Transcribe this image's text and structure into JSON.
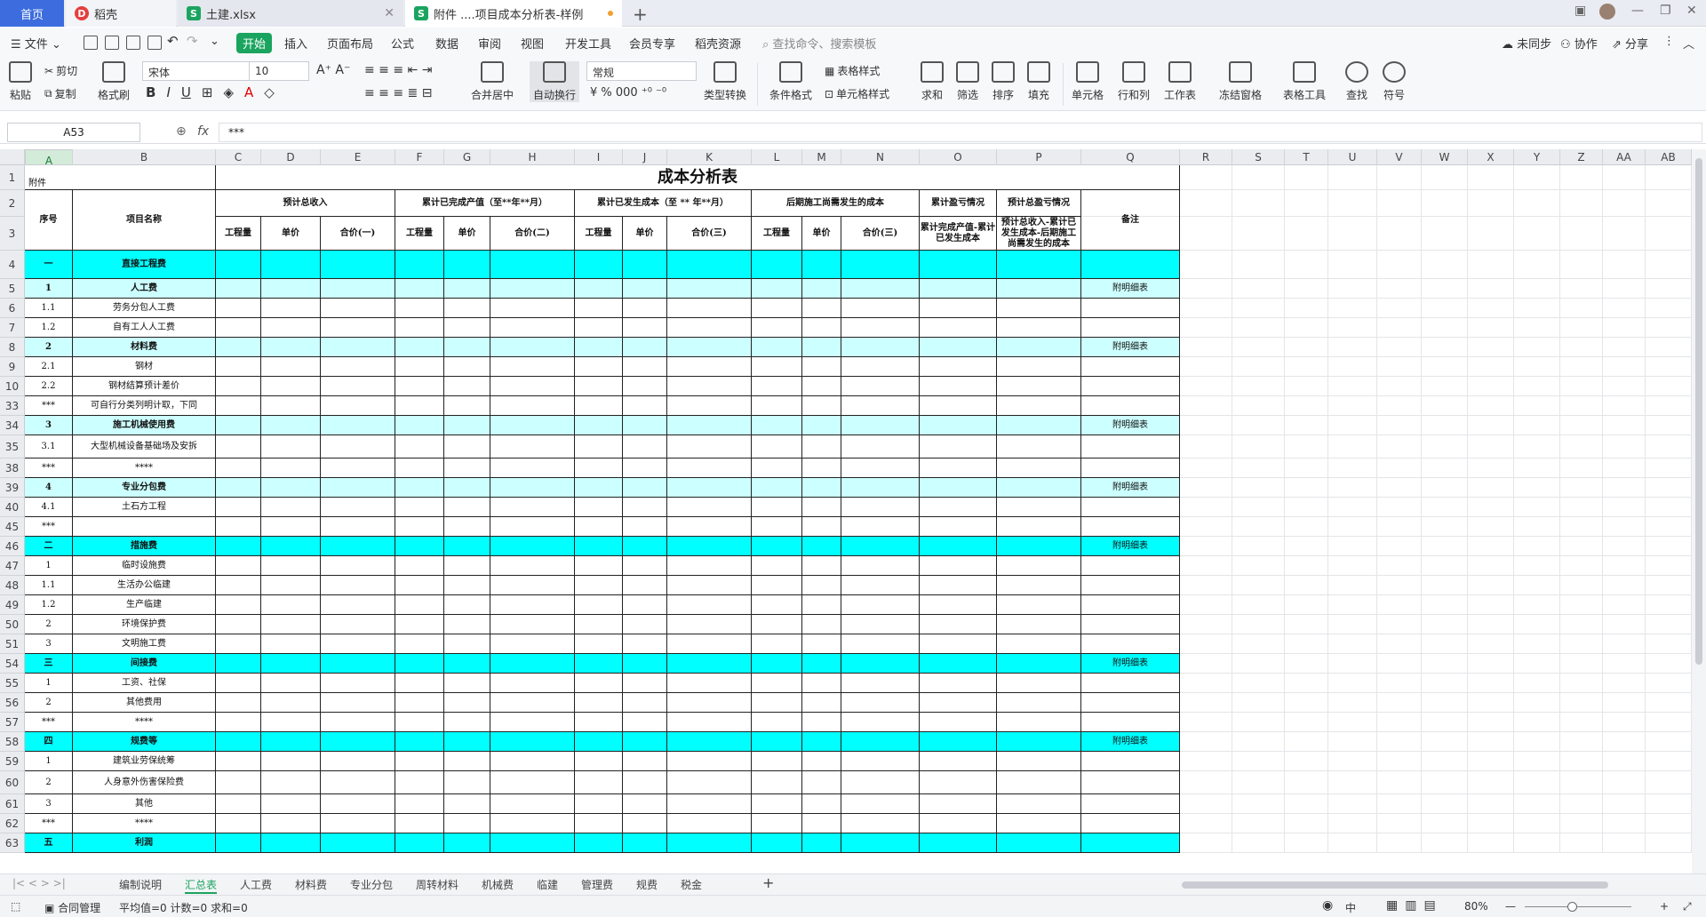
{
  "tabs": {
    "home": "首页",
    "t1": "稻壳",
    "t2": "土建.xlsx",
    "t3": "附件 ....项目成本分析表-样例"
  },
  "menu": {
    "file": "文件",
    "items": [
      "开始",
      "插入",
      "页面布局",
      "公式",
      "数据",
      "审阅",
      "视图",
      "开发工具",
      "会员专享",
      "稻壳资源"
    ],
    "search": "查找命令、搜索模板",
    "sync": "未同步",
    "collab": "协作",
    "share": "分享"
  },
  "ribbon": {
    "paste": "粘贴",
    "cut": "剪切",
    "copy": "复制",
    "format_painter": "格式刷",
    "font": "宋体",
    "size": "10",
    "merge": "合并居中",
    "wrap": "自动换行",
    "numfmt": "常规",
    "convert": "类型转换",
    "cond": "条件格式",
    "table_style": "表格样式",
    "cell_style": "单元格样式",
    "sum": "求和",
    "filter": "筛选",
    "sort": "排序",
    "fill": "填充",
    "cells": "单元格",
    "rowcol": "行和列",
    "worksheet": "工作表",
    "freeze": "冻结窗格",
    "tabletools": "表格工具",
    "find": "查找",
    "symbol": "符号"
  },
  "formula": {
    "namebox": "A53",
    "fx": "fx",
    "value": "***"
  },
  "columns": [
    "A",
    "B",
    "C",
    "D",
    "E",
    "F",
    "G",
    "H",
    "I",
    "J",
    "K",
    "L",
    "M",
    "N",
    "O",
    "P",
    "Q",
    "R",
    "S",
    "T",
    "U",
    "V",
    "W",
    "X",
    "Y",
    "Z",
    "AA",
    "AB"
  ],
  "title": "成本分析表",
  "attach": "附件",
  "headers": {
    "seq": "序号",
    "name": "项目名称",
    "g1": "预计总收入",
    "g2": "累计已完成产值（至**年**月）",
    "g3": "累计已发生成本（至 ** 年**月）",
    "g4": "后期施工尚需发生的成本",
    "g5": "累计盈亏情况",
    "g6": "预计总盈亏情况",
    "note": "备注",
    "qty": "工程量",
    "price": "单价",
    "s1": "合价(一)",
    "s2": "合价(二)",
    "s3": "合价(三)",
    "s4": "合价(三)",
    "p1": "累计完成产值-累计已发生成本",
    "p2": "预计总收入-累计已发生成本-后期施工尚需发生的成本"
  },
  "rows": [
    {
      "n": "4",
      "seq": "一",
      "name": "直接工程费",
      "note": "",
      "style": "cyan"
    },
    {
      "n": "5",
      "seq": "1",
      "name": "人工费",
      "note": "附明细表",
      "style": "light"
    },
    {
      "n": "6",
      "seq": "1.1",
      "name": "劳务分包人工费",
      "note": "",
      "style": ""
    },
    {
      "n": "7",
      "seq": "1.2",
      "name": "自有工人人工费",
      "note": "",
      "style": ""
    },
    {
      "n": "8",
      "seq": "2",
      "name": "材料费",
      "note": "附明细表",
      "style": "light"
    },
    {
      "n": "9",
      "seq": "2.1",
      "name": "钢材",
      "note": "",
      "style": ""
    },
    {
      "n": "10",
      "seq": "2.2",
      "name": "钢材结算预计差价",
      "note": "",
      "style": ""
    },
    {
      "n": "33",
      "seq": "***",
      "name": "可自行分类列明计取，下同",
      "note": "",
      "style": ""
    },
    {
      "n": "34",
      "seq": "3",
      "name": "施工机械使用费",
      "note": "附明细表",
      "style": "light"
    },
    {
      "n": "35",
      "seq": "3.1",
      "name": "大型机械设备基础场及安拆",
      "note": "",
      "style": ""
    },
    {
      "n": "38",
      "seq": "***",
      "name": "****",
      "note": "",
      "style": ""
    },
    {
      "n": "39",
      "seq": "4",
      "name": "专业分包费",
      "note": "附明细表",
      "style": "light"
    },
    {
      "n": "40",
      "seq": "4.1",
      "name": "土石方工程",
      "note": "",
      "style": ""
    },
    {
      "n": "45",
      "seq": "***",
      "name": "",
      "note": "",
      "style": ""
    },
    {
      "n": "46",
      "seq": "二",
      "name": "措施费",
      "note": "附明细表",
      "style": "cyan"
    },
    {
      "n": "47",
      "seq": "1",
      "name": "临时设施费",
      "note": "",
      "style": ""
    },
    {
      "n": "48",
      "seq": "1.1",
      "name": "生活办公临建",
      "note": "",
      "style": ""
    },
    {
      "n": "49",
      "seq": "1.2",
      "name": "生产临建",
      "note": "",
      "style": ""
    },
    {
      "n": "50",
      "seq": "2",
      "name": "环境保护费",
      "note": "",
      "style": ""
    },
    {
      "n": "51",
      "seq": "3",
      "name": "文明施工费",
      "note": "",
      "style": ""
    },
    {
      "n": "54",
      "seq": "三",
      "name": "间接费",
      "note": "附明细表",
      "style": "cyan"
    },
    {
      "n": "55",
      "seq": "1",
      "name": "工资、社保",
      "note": "",
      "style": ""
    },
    {
      "n": "56",
      "seq": "2",
      "name": "其他费用",
      "note": "",
      "style": ""
    },
    {
      "n": "57",
      "seq": "***",
      "name": "****",
      "note": "",
      "style": ""
    },
    {
      "n": "58",
      "seq": "四",
      "name": "规费等",
      "note": "附明细表",
      "style": "cyan"
    },
    {
      "n": "59",
      "seq": "1",
      "name": "建筑业劳保统筹",
      "note": "",
      "style": ""
    },
    {
      "n": "60",
      "seq": "2",
      "name": "人身意外伤害保险费",
      "note": "",
      "style": ""
    },
    {
      "n": "61",
      "seq": "3",
      "name": "其他",
      "note": "",
      "style": ""
    },
    {
      "n": "62",
      "seq": "***",
      "name": "****",
      "note": "",
      "style": ""
    },
    {
      "n": "63",
      "seq": "五",
      "name": "利润",
      "note": "",
      "style": "cyan"
    }
  ],
  "sheets": [
    "编制说明",
    "汇总表",
    "人工费",
    "材料费",
    "专业分包",
    "周转材料",
    "机械费",
    "临建",
    "管理费",
    "规费",
    "税金"
  ],
  "status": {
    "contract": "合同管理",
    "stats": "平均值=0  计数=0  求和=0",
    "zoom": "80%"
  },
  "colors": {
    "cyan": "#00ffff",
    "light": "#ccffff",
    "accent": "#1aa45f"
  }
}
